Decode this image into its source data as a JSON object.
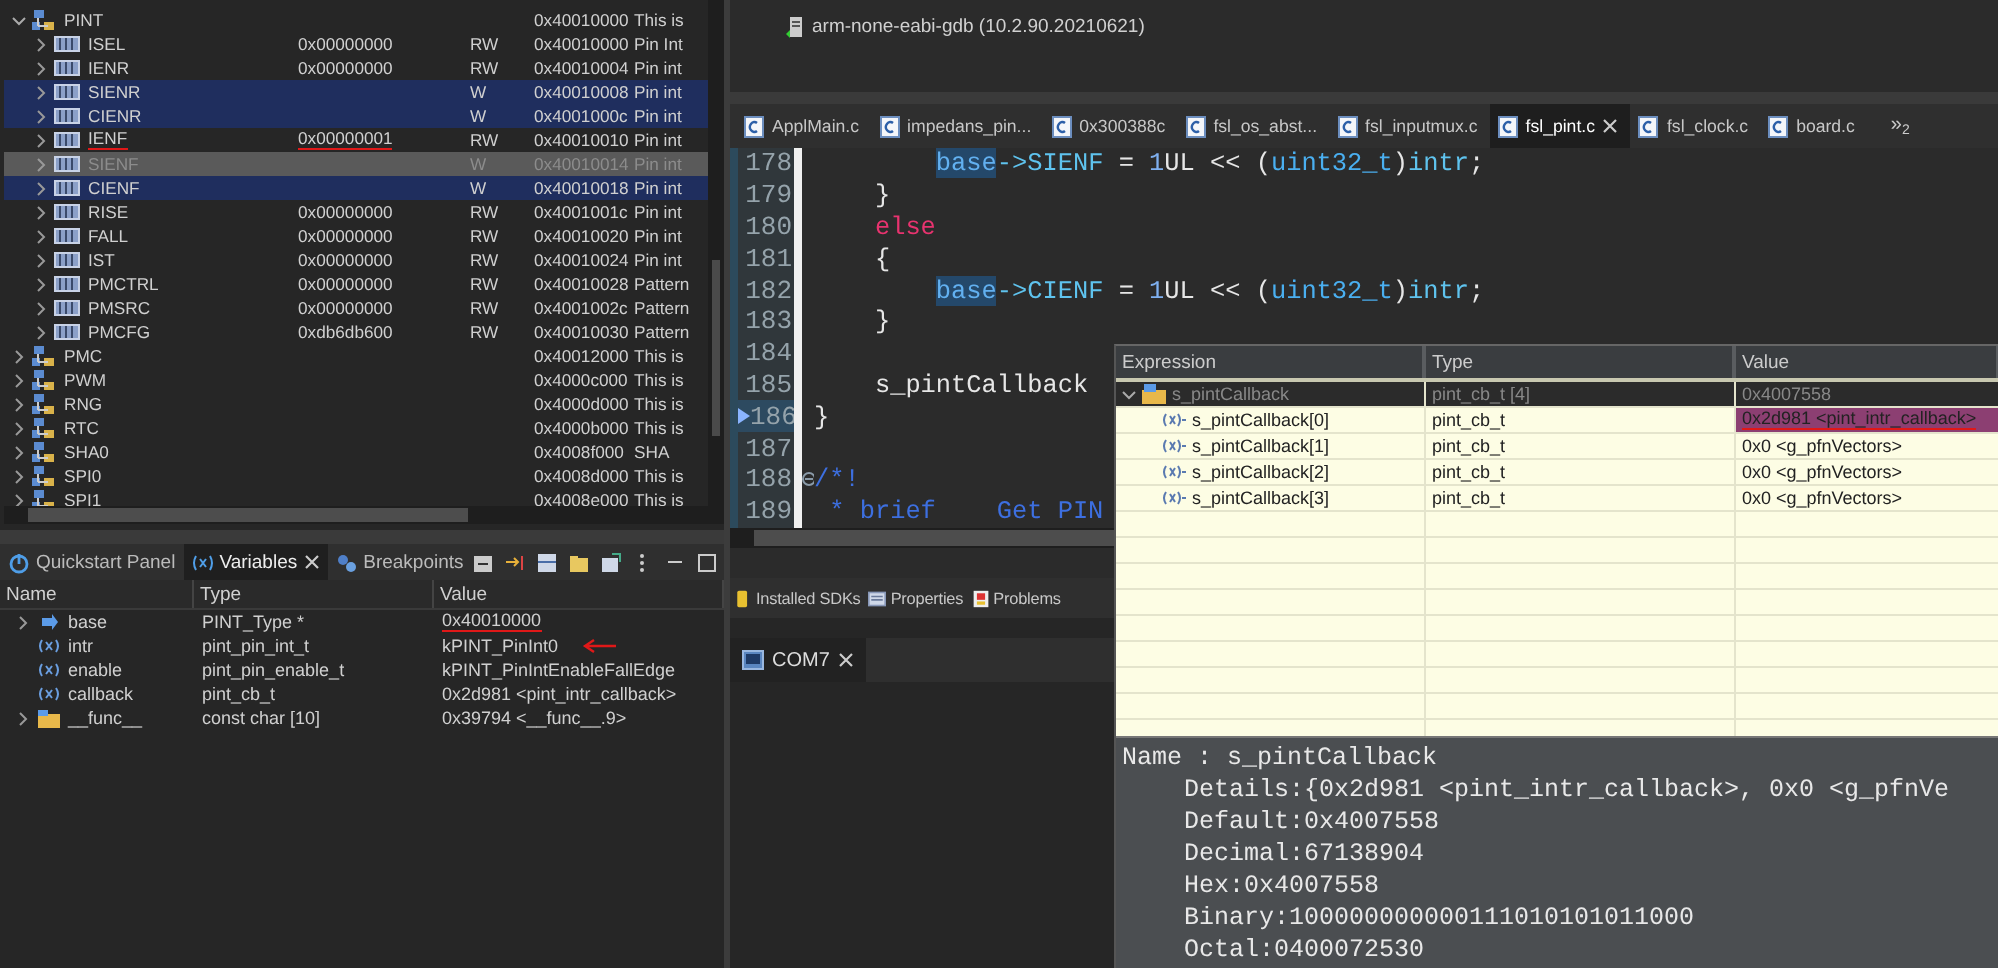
{
  "registers": {
    "rows": [
      {
        "name": "PINT",
        "kind": "peripheral",
        "expanded": true,
        "selected": false,
        "disabled": false,
        "marked": false,
        "value": "",
        "access": "",
        "address": "0x40010000",
        "description": "This is",
        "children": [
          {
            "name": "ISEL",
            "kind": "register",
            "expanded": false,
            "selected": false,
            "disabled": false,
            "marked": false,
            "value": "0x00000000",
            "access": "RW",
            "address": "0x40010000",
            "description": "Pin Int"
          },
          {
            "name": "IENR",
            "kind": "register",
            "expanded": false,
            "selected": false,
            "disabled": false,
            "marked": false,
            "value": "0x00000000",
            "access": "RW",
            "address": "0x40010004",
            "description": "Pin int"
          },
          {
            "name": "SIENR",
            "kind": "register",
            "expanded": false,
            "selected": true,
            "disabled": false,
            "marked": false,
            "access": "W",
            "address": "0x40010008",
            "description": "Pin int"
          },
          {
            "name": "CIENR",
            "kind": "register",
            "expanded": false,
            "selected": true,
            "disabled": false,
            "marked": false,
            "access": "W",
            "address": "0x4001000c",
            "description": "Pin int"
          },
          {
            "name": "IENF",
            "kind": "register",
            "expanded": false,
            "selected": false,
            "disabled": false,
            "marked": true,
            "value": "0x00000001",
            "access": "RW",
            "address": "0x40010010",
            "description": "Pin int"
          },
          {
            "name": "SIENF",
            "kind": "register",
            "expanded": false,
            "selected": true,
            "disabled": true,
            "marked": false,
            "access": "W",
            "address": "0x40010014",
            "description": "Pin int"
          },
          {
            "name": "CIENF",
            "kind": "register",
            "expanded": false,
            "selected": true,
            "disabled": false,
            "marked": false,
            "access": "W",
            "address": "0x40010018",
            "description": "Pin int"
          },
          {
            "name": "RISE",
            "kind": "register",
            "expanded": false,
            "selected": false,
            "disabled": false,
            "marked": false,
            "value": "0x00000000",
            "access": "RW",
            "address": "0x4001001c",
            "description": "Pin int"
          },
          {
            "name": "FALL",
            "kind": "register",
            "expanded": false,
            "selected": false,
            "disabled": false,
            "marked": false,
            "value": "0x00000000",
            "access": "RW",
            "address": "0x40010020",
            "description": "Pin int"
          },
          {
            "name": "IST",
            "kind": "register",
            "expanded": false,
            "selected": false,
            "disabled": false,
            "marked": false,
            "value": "0x00000000",
            "access": "RW",
            "address": "0x40010024",
            "description": "Pin int"
          },
          {
            "name": "PMCTRL",
            "kind": "register",
            "expanded": false,
            "selected": false,
            "disabled": false,
            "marked": false,
            "value": "0x00000000",
            "access": "RW",
            "address": "0x40010028",
            "description": "Pattern"
          },
          {
            "name": "PMSRC",
            "kind": "register",
            "expanded": false,
            "selected": false,
            "disabled": false,
            "marked": false,
            "value": "0x00000000",
            "access": "RW",
            "address": "0x4001002c",
            "description": "Pattern"
          },
          {
            "name": "PMCFG",
            "kind": "register",
            "expanded": false,
            "selected": false,
            "disabled": false,
            "marked": false,
            "value": "0xdb6db600",
            "access": "RW",
            "address": "0x40010030",
            "description": "Pattern"
          }
        ]
      },
      {
        "name": "PMC",
        "kind": "peripheral",
        "expanded": false,
        "selected": false,
        "disabled": false,
        "marked": false,
        "value": "",
        "access": "",
        "address": "0x40012000",
        "description": "This is"
      },
      {
        "name": "PWM",
        "kind": "peripheral",
        "expanded": false,
        "selected": false,
        "disabled": false,
        "marked": false,
        "value": "",
        "access": "",
        "address": "0x4000c000",
        "description": "This is"
      },
      {
        "name": "RNG",
        "kind": "peripheral",
        "expanded": false,
        "selected": false,
        "disabled": false,
        "marked": false,
        "value": "",
        "access": "",
        "address": "0x4000d000",
        "description": "This is"
      },
      {
        "name": "RTC",
        "kind": "peripheral",
        "expanded": false,
        "selected": false,
        "disabled": false,
        "marked": false,
        "value": "",
        "access": "",
        "address": "0x4000b000",
        "description": "This is"
      },
      {
        "name": "SHA0",
        "kind": "peripheral",
        "expanded": false,
        "selected": false,
        "disabled": false,
        "marked": false,
        "value": "",
        "access": "",
        "address": "0x4008f000",
        "description": "SHA"
      },
      {
        "name": "SPI0",
        "kind": "peripheral",
        "expanded": false,
        "selected": false,
        "disabled": false,
        "marked": false,
        "value": "",
        "access": "",
        "address": "0x4008d000",
        "description": "This is"
      },
      {
        "name": "SPI1",
        "kind": "peripheral",
        "expanded": false,
        "selected": false,
        "disabled": false,
        "marked": false,
        "value": "",
        "access": "",
        "address": "0x4008e000",
        "description": "This is"
      }
    ]
  },
  "variables": {
    "tabs": [
      {
        "label": "Quickstart Panel",
        "kind": "quickstart",
        "selected": false,
        "closable": false
      },
      {
        "label": "Variables",
        "kind": "variables",
        "selected": true,
        "closable": true
      },
      {
        "label": "Breakpoints",
        "kind": "breakpoints",
        "selected": false,
        "closable": false
      }
    ],
    "columns": [
      "Name",
      "Type",
      "Value"
    ],
    "rows": [
      {
        "name": "base",
        "kind": "pointer",
        "expandable": true,
        "type": "PINT_Type *",
        "value": "0x40010000",
        "marked": true,
        "arrow": false
      },
      {
        "name": "intr",
        "kind": "variable",
        "expandable": false,
        "type": "pint_pin_int_t",
        "value": "kPINT_PinInt0",
        "marked": false,
        "arrow": true
      },
      {
        "name": "enable",
        "kind": "variable",
        "expandable": false,
        "type": "pint_pin_enable_t",
        "value": "kPINT_PinIntEnableFallEdge",
        "marked": false,
        "arrow": false
      },
      {
        "name": "callback",
        "kind": "variable",
        "expandable": false,
        "type": "pint_cb_t",
        "value": "0x2d981 <pint_intr_callback>",
        "marked": false,
        "arrow": false
      },
      {
        "name": "__func__",
        "kind": "array",
        "expandable": true,
        "type": "const char [10]",
        "value": "0x39794 <__func__.9>",
        "marked": false,
        "arrow": false
      }
    ]
  },
  "debug": {
    "items": [
      {
        "label": "arm-none-eabi-gdb (10.2.90.20210621)"
      }
    ]
  },
  "editor": {
    "tabs": [
      {
        "label": "ApplMain.c",
        "selected": false
      },
      {
        "label": "impedans_pin...",
        "selected": false
      },
      {
        "label": "0x300388c",
        "selected": false
      },
      {
        "label": "fsl_os_abst...",
        "selected": false
      },
      {
        "label": "fsl_inputmux.c",
        "selected": false
      },
      {
        "label": "fsl_pint.c",
        "selected": true
      },
      {
        "label": "fsl_clock.c",
        "selected": false
      },
      {
        "label": "board.c",
        "selected": false
      }
    ],
    "overflow": {
      "label": "»",
      "count": "2"
    },
    "lines": [
      {
        "num": "178",
        "current": false,
        "foldable": false,
        "tokens": [
          {
            "t": "        base",
            "kind": "var"
          },
          {
            "t": "->SIENF",
            "kind": "field"
          },
          {
            "t": " = ",
            "kind": "plain"
          },
          {
            "t": "1",
            "kind": "num"
          },
          {
            "t": "UL << (",
            "kind": "plain"
          },
          {
            "t": "uint32_t",
            "kind": "type"
          },
          {
            "t": ")",
            "kind": "plain"
          },
          {
            "t": "intr",
            "kind": "field"
          },
          {
            "t": ";",
            "kind": "plain"
          }
        ]
      },
      {
        "num": "179",
        "current": false,
        "foldable": false,
        "tokens": [
          {
            "t": "    }",
            "kind": "plain"
          }
        ]
      },
      {
        "num": "180",
        "current": false,
        "foldable": false,
        "tokens": [
          {
            "t": "    else",
            "kind": "kw"
          }
        ]
      },
      {
        "num": "181",
        "current": false,
        "foldable": false,
        "tokens": [
          {
            "t": "    {",
            "kind": "plain"
          }
        ]
      },
      {
        "num": "182",
        "current": false,
        "foldable": false,
        "tokens": [
          {
            "t": "        base",
            "kind": "var"
          },
          {
            "t": "->CIENF",
            "kind": "field"
          },
          {
            "t": " = ",
            "kind": "plain"
          },
          {
            "t": "1",
            "kind": "num"
          },
          {
            "t": "UL << (",
            "kind": "plain"
          },
          {
            "t": "uint32_t",
            "kind": "type"
          },
          {
            "t": ")",
            "kind": "plain"
          },
          {
            "t": "intr",
            "kind": "field"
          },
          {
            "t": ";",
            "kind": "plain"
          }
        ]
      },
      {
        "num": "183",
        "current": false,
        "foldable": false,
        "tokens": [
          {
            "t": "    }",
            "kind": "plain"
          }
        ]
      },
      {
        "num": "184",
        "current": false,
        "foldable": false
      },
      {
        "num": "185",
        "current": false,
        "foldable": false,
        "tokens": [
          {
            "t": "    s_pintCallback",
            "kind": "plain"
          }
        ]
      },
      {
        "num": "186",
        "current": true,
        "foldable": false,
        "tokens": [
          {
            "t": "}",
            "kind": "plain"
          }
        ]
      },
      {
        "num": "187",
        "current": false,
        "foldable": false
      },
      {
        "num": "188",
        "current": false,
        "foldable": true,
        "tokens": [
          {
            "t": "/*!",
            "kind": "comment"
          }
        ]
      },
      {
        "num": "189",
        "current": false,
        "foldable": false,
        "tokens": [
          {
            "t": " * brief    Get PIN",
            "kind": "comment"
          }
        ]
      }
    ]
  },
  "views": {
    "tabs": [
      {
        "label": "Installed SDKs",
        "kind": "sdk",
        "selected": false
      },
      {
        "label": "Properties",
        "kind": "properties",
        "selected": false
      },
      {
        "label": "Problems",
        "kind": "problems",
        "selected": false
      }
    ]
  },
  "console": {
    "tabs": [
      {
        "label": "COM7",
        "selected": true,
        "closable": true
      }
    ]
  },
  "hover": {
    "columns": [
      "Expression",
      "Type",
      "Value"
    ],
    "rows": [
      {
        "expression": "s_pintCallback",
        "type": "pint_cb_t [4]",
        "value": "0x4007558",
        "expanded": true,
        "selected": true,
        "changed": false,
        "marked": false,
        "children": [
          {
            "expression": "s_pintCallback[0]",
            "type": "pint_cb_t",
            "value": "0x2d981 <pint_intr_callback>",
            "selected": false,
            "changed": true,
            "marked": true
          },
          {
            "expression": "s_pintCallback[1]",
            "type": "pint_cb_t",
            "value": "0x0 <g_pfnVectors>",
            "selected": false,
            "changed": false,
            "marked": false
          },
          {
            "expression": "s_pintCallback[2]",
            "type": "pint_cb_t",
            "value": "0x0 <g_pfnVectors>",
            "selected": false,
            "changed": false,
            "marked": false
          },
          {
            "expression": "s_pintCallback[3]",
            "type": "pint_cb_t",
            "value": "0x0 <g_pfnVectors>",
            "selected": false,
            "changed": false,
            "marked": false
          }
        ]
      }
    ],
    "details": {
      "title": "Name : s_pintCallback",
      "lines": [
        "Details:{0x2d981 <pint_intr_callback>, 0x0 <g_pfnVe",
        "Default:0x4007558",
        "Decimal:67138904",
        "Hex:0x4007558",
        "Binary:100000000000111010101011000",
        "Octal:0400072530"
      ]
    }
  }
}
